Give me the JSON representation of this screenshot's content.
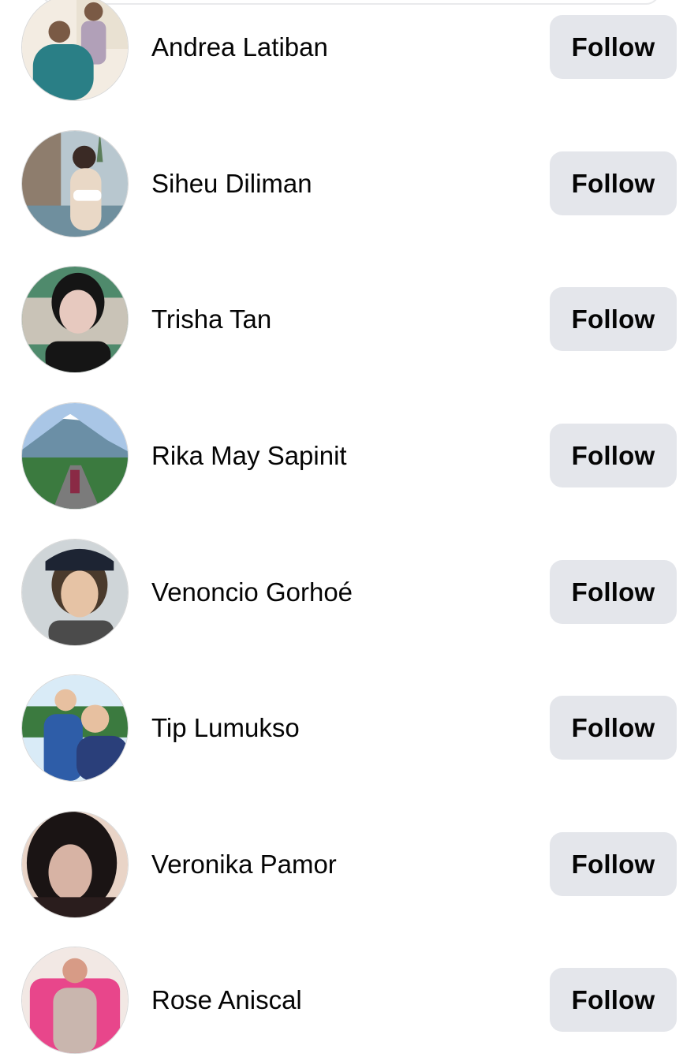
{
  "people": [
    {
      "name": "Andrea Latiban",
      "follow_label": "Follow",
      "avatar_icon": "profile-photo-couple-indoor",
      "colors": [
        "#f3ece2",
        "#2a7f86",
        "#b1a0b8",
        "#7a5a45"
      ]
    },
    {
      "name": "Siheu Diliman",
      "follow_label": "Follow",
      "avatar_icon": "profile-photo-poolside",
      "colors": [
        "#b8c7cf",
        "#e9d8c6",
        "#5b7d5a",
        "#3a2a25"
      ]
    },
    {
      "name": "Trisha Tan",
      "follow_label": "Follow",
      "avatar_icon": "profile-photo-selfie",
      "colors": [
        "#4f8a6c",
        "#e7c9bf",
        "#151515",
        "#c9c3b7"
      ]
    },
    {
      "name": "Rika May Sapinit",
      "follow_label": "Follow",
      "avatar_icon": "profile-photo-volcano-road",
      "colors": [
        "#a9c6e6",
        "#6b8fa6",
        "#3b7a3f",
        "#7b7b7b"
      ]
    },
    {
      "name": "Venoncio Gorhoé",
      "follow_label": "Follow",
      "avatar_icon": "profile-photo-cap",
      "colors": [
        "#cfd5d8",
        "#e6c3a5",
        "#4a3a2c",
        "#1d2433"
      ]
    },
    {
      "name": "Tip Lumukso",
      "follow_label": "Follow",
      "avatar_icon": "profile-photo-couple-outdoor",
      "colors": [
        "#d9ebf7",
        "#2e5da8",
        "#e7c0a0",
        "#3b7a3f"
      ]
    },
    {
      "name": "Veronika Pamor",
      "follow_label": "Follow",
      "avatar_icon": "profile-photo-dark-hair",
      "colors": [
        "#e9d4c7",
        "#1a1414",
        "#d7b3a4",
        "#2a1d1d"
      ]
    },
    {
      "name": "Rose Aniscal",
      "follow_label": "Follow",
      "avatar_icon": "profile-photo-pink-sofa",
      "colors": [
        "#f2e8e4",
        "#e8468b",
        "#d79b86",
        "#c9b6ae"
      ]
    }
  ]
}
